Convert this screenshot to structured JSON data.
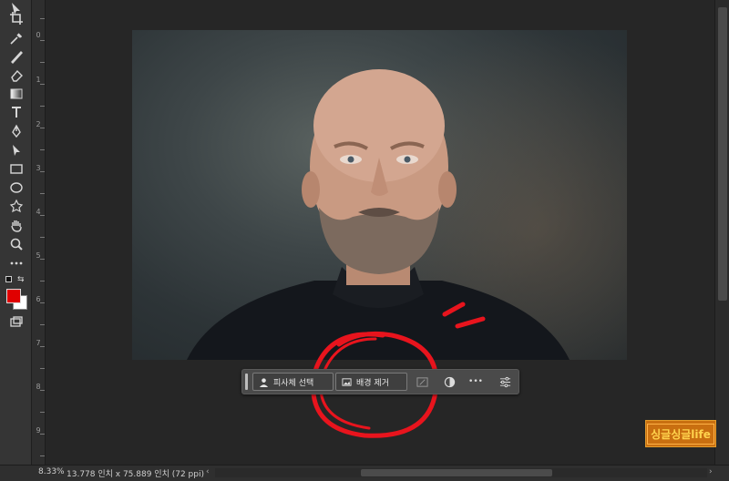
{
  "toolbar": {
    "tools": [
      "move-tool",
      "crop-tool",
      "eyedropper-tool",
      "brush-tool",
      "eraser-tool",
      "gradient-tool",
      "type-tool",
      "pen-tool",
      "path-selection-tool",
      "rectangle-tool",
      "ellipse-tool",
      "custom-shape-tool",
      "hand-tool",
      "zoom-tool",
      "more-tools"
    ],
    "foreground_color": "#e00000",
    "background_color": "#ffffff"
  },
  "ruler": {
    "labels": [
      "0",
      "1",
      "2",
      "3",
      "4",
      "5",
      "6",
      "7",
      "8",
      "9"
    ]
  },
  "context_bar": {
    "select_subject_label": "피사체 선택",
    "remove_background_label": "배경 제거",
    "more_label": "•••"
  },
  "status_bar": {
    "zoom": "8.33%",
    "doc_info": "13.778 인치 x 75.889 인치 (72 ppi)"
  },
  "watermark": {
    "text": "싱글싱글life"
  },
  "annotation_color": "#e8141d"
}
